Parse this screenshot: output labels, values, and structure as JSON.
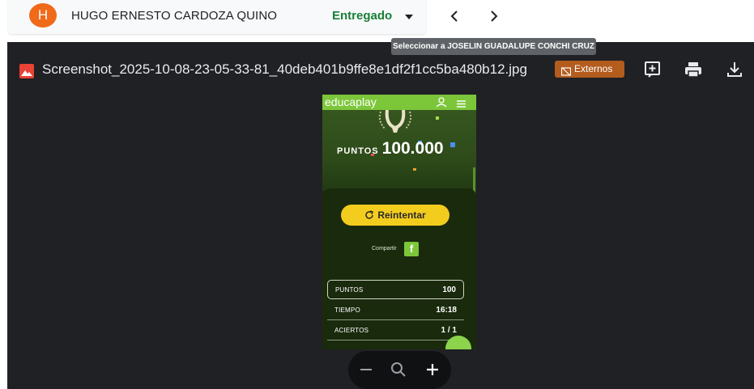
{
  "student": {
    "avatar_initial": "H",
    "name": "HUGO ERNESTO CARDOZA QUINO",
    "status": "Entregado",
    "colors": {
      "avatar": "#f06a1a",
      "status": "#188038"
    }
  },
  "navigation": {
    "prev_icon": "chevron-left-icon",
    "next_icon": "chevron-right-icon",
    "tooltip": "Seleccionar a JOSELIN GUADALUPE CONCHI CRUZ"
  },
  "viewer": {
    "file_icon": "image-file-icon",
    "file_name": "Screenshot_2025-10-08-23-05-33-81_40deb401b9ffe8e1df2f1cc5ba480b12.jpg",
    "badge_label": "Externos",
    "badge_color": "#b35c1e",
    "tools": [
      "add-comment-icon",
      "print-icon",
      "download-icon"
    ]
  },
  "phone": {
    "brand_bold": "educa",
    "brand_light": "play",
    "header_color": "#7cc63a",
    "hero_points_label": "PUNTOS",
    "hero_points_value": "100.000",
    "retry_label": "Reintentar",
    "share_label": "Compartir",
    "facebook_glyph": "f",
    "stats": [
      {
        "label": "PUNTOS",
        "value": "100"
      },
      {
        "label": "TIEMPO",
        "value": "16:18"
      },
      {
        "label": "ACIERTOS",
        "value": "1 / 1"
      }
    ]
  },
  "zoom": {
    "icons": [
      "zoom-out-icon",
      "zoom-reset-icon",
      "zoom-in-icon"
    ]
  }
}
